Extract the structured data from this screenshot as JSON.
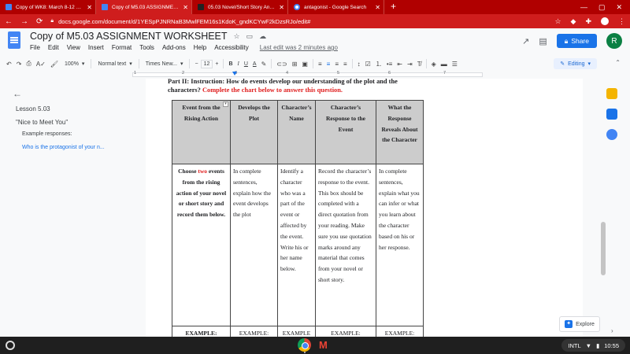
{
  "browser": {
    "tabs": [
      {
        "label": "Copy of WK8: March 8-12 SWAA...",
        "icon": "docs-icon",
        "active": false
      },
      {
        "label": "Copy of M5.03 ASSIGNMENT W...",
        "icon": "docs-icon",
        "active": true
      },
      {
        "label": "05.03 Novel/Short Story Analysi...",
        "icon": "page-icon",
        "active": false
      },
      {
        "label": "antagonist - Google Search",
        "icon": "google-icon",
        "active": false
      }
    ],
    "url": "docs.google.com/document/d/1YESpPJNRNaB3MwlFEM16s1KdoK_gndKCYwF2kDzsRJo/edit#"
  },
  "doc": {
    "title": "Copy of M5.03 ASSIGNMENT WORKSHEET",
    "menu": [
      "File",
      "Edit",
      "View",
      "Insert",
      "Format",
      "Tools",
      "Add-ons",
      "Help",
      "Accessibility"
    ],
    "last_edit": "Last edit was 2 minutes ago",
    "share_label": "Share",
    "avatar_letter": "R"
  },
  "toolbar": {
    "zoom": "100%",
    "style": "Normal text",
    "font": "Times New...",
    "font_size": "12",
    "bold": "B",
    "italic": "I",
    "underline": "U",
    "text_color": "A",
    "mode": "Editing"
  },
  "ruler": {
    "marks": [
      "1",
      "2",
      "3",
      "4",
      "5",
      "6",
      "7"
    ]
  },
  "outline": {
    "title": "Lesson 5.03",
    "subtitle": "\"Nice to Meet You\"",
    "items": [
      "Example responses:",
      "Who is the protagonist of your n..."
    ]
  },
  "content": {
    "heading_black": "Part II: Instruction: How do events develop our understanding of the plot and the characters?",
    "heading_red": "Complete the chart below to answer this question.",
    "table": {
      "headers": [
        "Event from the Rising Action",
        "Develops the Plot",
        "Character’s Name",
        "Character’s Response to the Event",
        "What the Response Reveals About the Character"
      ],
      "row1": {
        "c1_pre": "Choose ",
        "c1_red": "two",
        "c1_post": " events from the rising action of your novel or short story and record them below.",
        "c2": "In complete sentences, explain how the event develops the plot",
        "c3": "Identify a character who was a part of the event or affected by the event. Write his or her name below.",
        "c4": "Record the character’s response to the event. This box should be completed with a direct quotation from your reading. Make sure you use quotation marks around any material that comes from your novel or short story.",
        "c5": "In complete sentences, explain what you can infer or what you learn about the character based on his or her response."
      },
      "example_row": [
        "EXAMPLE:",
        "EXAMPLE:",
        "EXAMPLE",
        "EXAMPLE:",
        "EXAMPLE:"
      ]
    }
  },
  "explore_label": "Explore",
  "tray": {
    "input": "INTL",
    "time": "10:55"
  },
  "colors": {
    "chrome_red": "#cf1d1d",
    "accent": "#1a73e8",
    "instruction_red": "#e02020"
  }
}
